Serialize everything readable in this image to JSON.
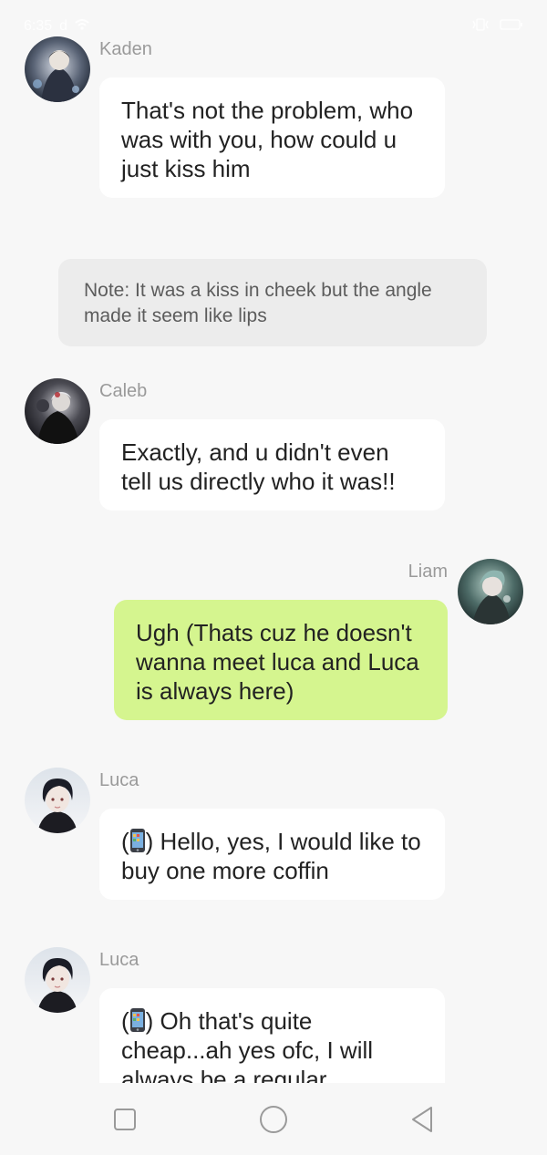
{
  "status_bar": {
    "time": "6:35",
    "indicator": "d"
  },
  "messages": [
    {
      "sender": "Kaden",
      "text": "That's not the problem, who was with you, how could u just kiss him",
      "is_me": false
    },
    {
      "sender": "Caleb",
      "text": "Exactly, and u didn't even tell us directly who it was!!",
      "is_me": false
    },
    {
      "sender": "Liam",
      "text": "Ugh (Thats cuz he doesn't wanna meet luca and Luca is always here)",
      "is_me": true
    },
    {
      "sender": "Luca",
      "text_open": "(",
      "text_after": ") Hello, yes, I would like to buy one more coffin",
      "is_me": false
    },
    {
      "sender": "Luca",
      "text_open": "(",
      "text_after": ") Oh that's quite cheap...ah yes ofc, I will always be a regular",
      "is_me": false
    }
  ],
  "note": {
    "text": "Note: It was a kiss in cheek but the angle made it seem like lips"
  },
  "icons": {
    "back": "back-triangle-icon",
    "home": "home-circle-icon",
    "recents": "recents-square-icon",
    "phone": "mobile-phone-icon"
  },
  "colors": {
    "my_bubble": "#d5f58f",
    "bubble": "#ffffff",
    "background": "#f7f7f7",
    "note_bg": "#ececec"
  }
}
